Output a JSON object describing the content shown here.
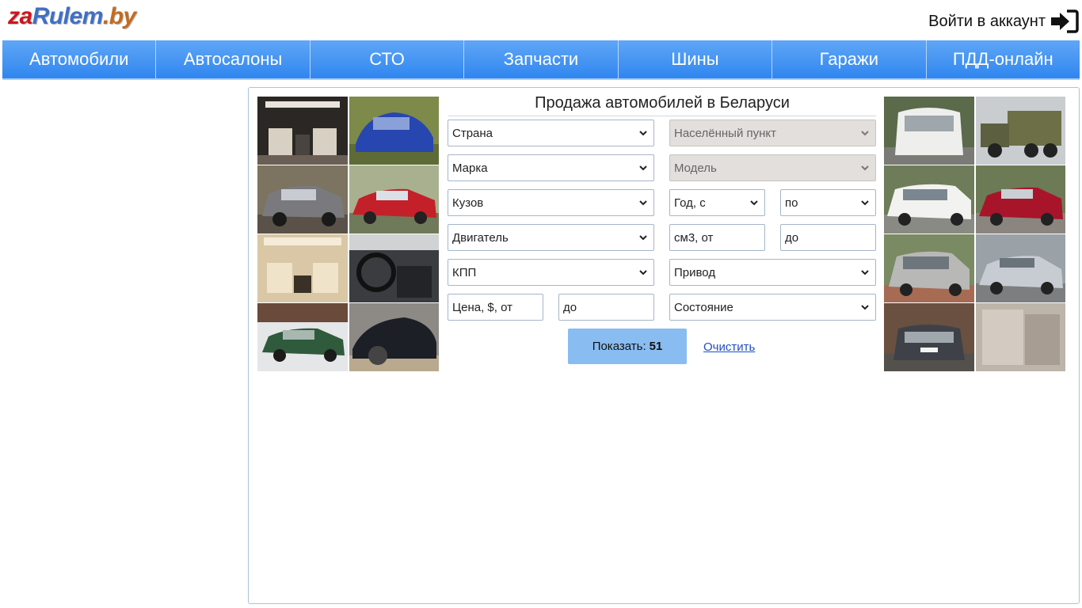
{
  "header": {
    "logo": {
      "za": "za",
      "rulem": "Rulem",
      "by": ".by"
    },
    "login_label": "Войти в аккаунт"
  },
  "nav": {
    "items": [
      "Автомобили",
      "Автосалоны",
      "СТО",
      "Запчасти",
      "Шины",
      "Гаражи",
      "ПДД-онлайн"
    ]
  },
  "search": {
    "title": "Продажа автомобилей в Беларуси",
    "country": "Страна",
    "locality": "Населённый пункт",
    "brand": "Марка",
    "model": "Модель",
    "body": "Кузов",
    "year_from": "Год, с",
    "year_to": "по",
    "engine": "Двигатель",
    "volume_from": "см3, от",
    "volume_to": "до",
    "gearbox": "КПП",
    "drive": "Привод",
    "price_from": "Цена, $, от",
    "price_to": "до",
    "condition": "Состояние",
    "show_label": "Показать:",
    "show_count": "51",
    "clear_label": "Очистить"
  },
  "colors": {
    "nav_top": "#60a6f7",
    "nav_bottom": "#2f86ef",
    "button": "#89bcf0",
    "link": "#1f4fc4"
  }
}
